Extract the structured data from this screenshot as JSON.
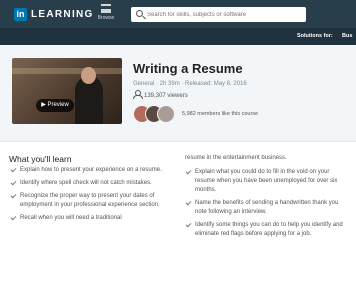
{
  "header": {
    "logo_mark": "in",
    "logo_text": "LEARNING",
    "browse_label": "Browse",
    "search_placeholder": "Search for skills, subjects or software",
    "solutions_label": "Solutions for:",
    "business_label": "Bus"
  },
  "course": {
    "title": "Writing a Resume",
    "meta": "General · 2h 39m · Released: May 8, 2016",
    "viewers": "139,307 viewers",
    "members_text": "5,982 members like this course",
    "preview_label": "Preview"
  },
  "learn": {
    "heading": "What you'll learn",
    "left_items": [
      "Explain how to present your experience on a resume.",
      "Identify where spell check will not catch mistakes.",
      "Recognize the proper way to present your dates of employment in your professional experience section.",
      "Recall when you will need a traditional"
    ],
    "right_continuation": "resume in the entertainment business.",
    "right_items": [
      "Explain what you could do to fill in the void on your resume when you have been unemployed for over six months.",
      "Name the benefits of sending a handwritten thank you note following an interview.",
      "Identify some things you can do to help you identify and eliminate red flags before applying for a job."
    ]
  },
  "colors": {
    "header_bg": "#283e4a",
    "subbar_bg": "#1f323d",
    "brand": "#0077b5",
    "hero_bg": "#f3f6f8"
  },
  "icons": [
    "linkedin-logo-icon",
    "browse-grid-icon",
    "search-icon",
    "person-icon",
    "play-icon",
    "check-icon"
  ]
}
